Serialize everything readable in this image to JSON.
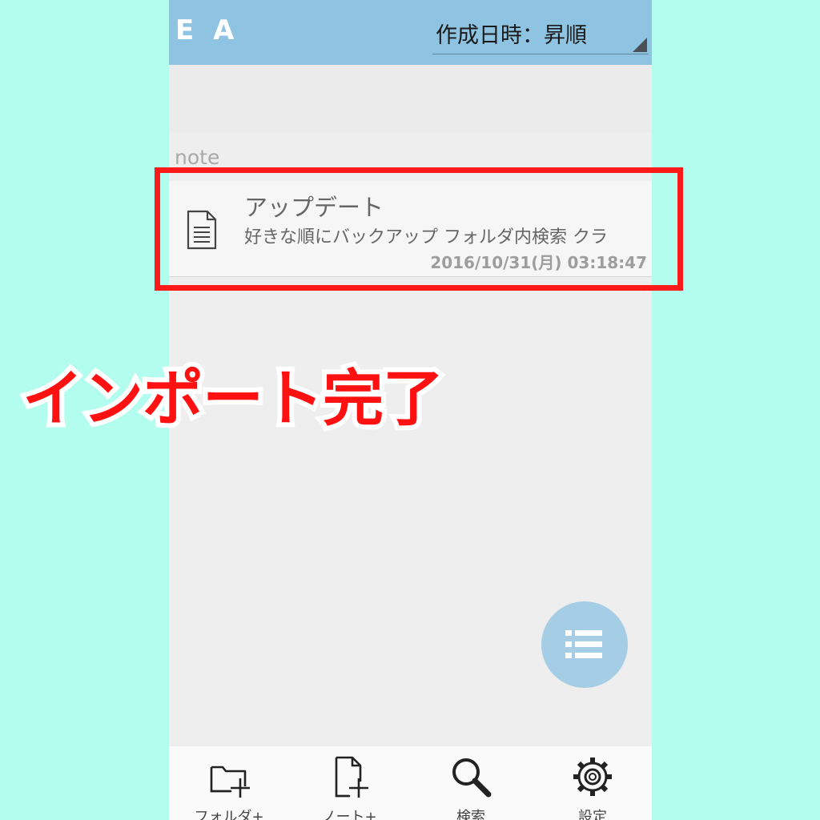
{
  "app": {
    "title": "E A"
  },
  "sort": {
    "selected": "作成日時：昇順"
  },
  "section": {
    "header": "note"
  },
  "note": {
    "title": "アップデート",
    "snippet": "好きな順にバックアップ フォルダ内検索 クラ",
    "date": "2016/10/31(月) 03:18:47",
    "icon": "document-icon"
  },
  "fab": {
    "icon": "list-icon"
  },
  "bottom_nav": [
    {
      "label": "フォルダ+",
      "icon": "folder-add-icon"
    },
    {
      "label": "ノート+",
      "icon": "note-add-icon"
    },
    {
      "label": "検索",
      "icon": "search-icon"
    },
    {
      "label": "設定",
      "icon": "gear-icon"
    }
  ],
  "overlay": {
    "caption": "インポート完了"
  },
  "colors": {
    "background": "#b3fdee",
    "appbar": "#8fc3e2",
    "fab": "#a6cde6",
    "highlight": "#ff1a1a"
  }
}
